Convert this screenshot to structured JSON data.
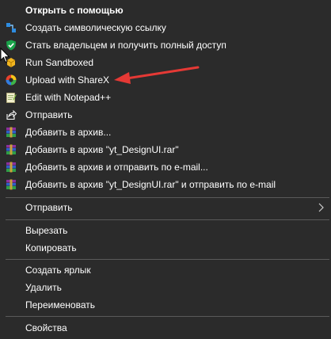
{
  "menu": {
    "header": "Открыть с помощью",
    "items": [
      {
        "label": "Создать символическую ссылку",
        "icon": "symlink-icon"
      },
      {
        "label": "Стать владельцем и получить полный доступ",
        "icon": "shield-check-icon"
      },
      {
        "label": "Run Sandboxed",
        "icon": "sandboxie-icon"
      },
      {
        "label": "Upload with ShareX",
        "icon": "sharex-icon"
      },
      {
        "label": "Edit with Notepad++",
        "icon": "notepadpp-icon"
      },
      {
        "label": "Отправить",
        "icon": "share-icon"
      },
      {
        "label": "Добавить в архив...",
        "icon": "winrar-icon"
      },
      {
        "label": "Добавить в архив \"yt_DesignUI.rar\"",
        "icon": "winrar-icon"
      },
      {
        "label": "Добавить в архив и отправить по e-mail...",
        "icon": "winrar-icon"
      },
      {
        "label": "Добавить в архив \"yt_DesignUI.rar\" и отправить по e-mail",
        "icon": "winrar-icon"
      }
    ],
    "send_to": "Отправить",
    "cut": "Вырезать",
    "copy": "Копировать",
    "create_shortcut": "Создать ярлык",
    "delete": "Удалить",
    "rename": "Переименовать",
    "properties": "Свойства"
  },
  "colors": {
    "background": "#2b2b2b",
    "text": "#ffffff",
    "separator": "#5a5a5a",
    "annotation_arrow": "#e53935"
  }
}
